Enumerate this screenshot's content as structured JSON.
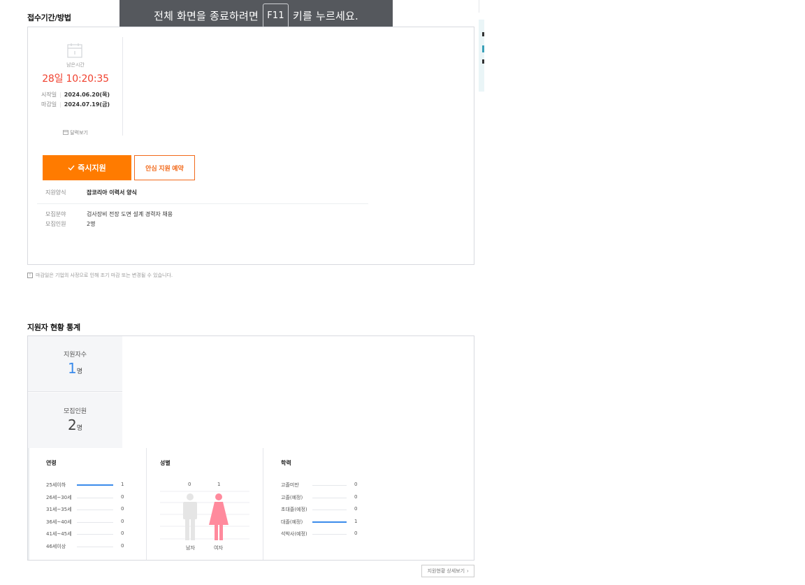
{
  "toast": {
    "prefix": "전체 화면을 종료하려면",
    "key": "F11",
    "suffix": "키를 누르세요."
  },
  "period": {
    "section_title": "접수기간/방법",
    "remain_label": "남은시간",
    "remain_time": "28일 10:20:35",
    "start_label": "시작일",
    "start_value": "2024.06.20(목)",
    "end_label": "마감일",
    "end_value": "2024.07.19(금)",
    "calendar_link": "달력보기",
    "apply_button": "즉시지원",
    "reserve_button": "안심 지원 예약",
    "form_label": "지원양식",
    "form_value": "잡코리아 이력서 양식",
    "field_label": "모집분야",
    "field_value": "검사장비 전장 도면 설계 경력자 채용",
    "headcount_label": "모집인원",
    "headcount_value": "2명",
    "notice": "마감일은 기업의 사정으로 인해 조기 마감 또는 변경될 수 있습니다."
  },
  "stats": {
    "section_title": "지원자 현황 통계",
    "applicants_label": "지원자수",
    "applicants_value": "1",
    "applicants_unit": "명",
    "recruit_label": "모집인원",
    "recruit_value": "2",
    "recruit_unit": "명",
    "age": {
      "title": "연령",
      "rows": [
        {
          "label": "25세이하",
          "value": "1",
          "fraction": 1.0
        },
        {
          "label": "26세~30세",
          "value": "0",
          "fraction": 0
        },
        {
          "label": "31세~35세",
          "value": "0",
          "fraction": 0
        },
        {
          "label": "36세~40세",
          "value": "0",
          "fraction": 0
        },
        {
          "label": "41세~45세",
          "value": "0",
          "fraction": 0
        },
        {
          "label": "46세이상",
          "value": "0",
          "fraction": 0
        }
      ]
    },
    "gender": {
      "title": "성별",
      "male_count": "0",
      "female_count": "1",
      "male_label": "남자",
      "female_label": "여자",
      "male_color": "#e5e5e5",
      "female_color": "#ff8a9d"
    },
    "education": {
      "title": "학력",
      "rows": [
        {
          "label": "고졸미만",
          "value": "0",
          "fraction": 0
        },
        {
          "label": "고졸(예정)",
          "value": "0",
          "fraction": 0
        },
        {
          "label": "초대졸(예정)",
          "value": "0",
          "fraction": 0
        },
        {
          "label": "대졸(예정)",
          "value": "1",
          "fraction": 1.0
        },
        {
          "label": "석박사(예정)",
          "value": "0",
          "fraction": 0
        }
      ]
    },
    "detail_button": "지원현황 상세보기"
  },
  "colors": {
    "accent_orange": "#ff7b00",
    "timer_red": "#f0412f",
    "bar_blue": "#3b8beb"
  }
}
